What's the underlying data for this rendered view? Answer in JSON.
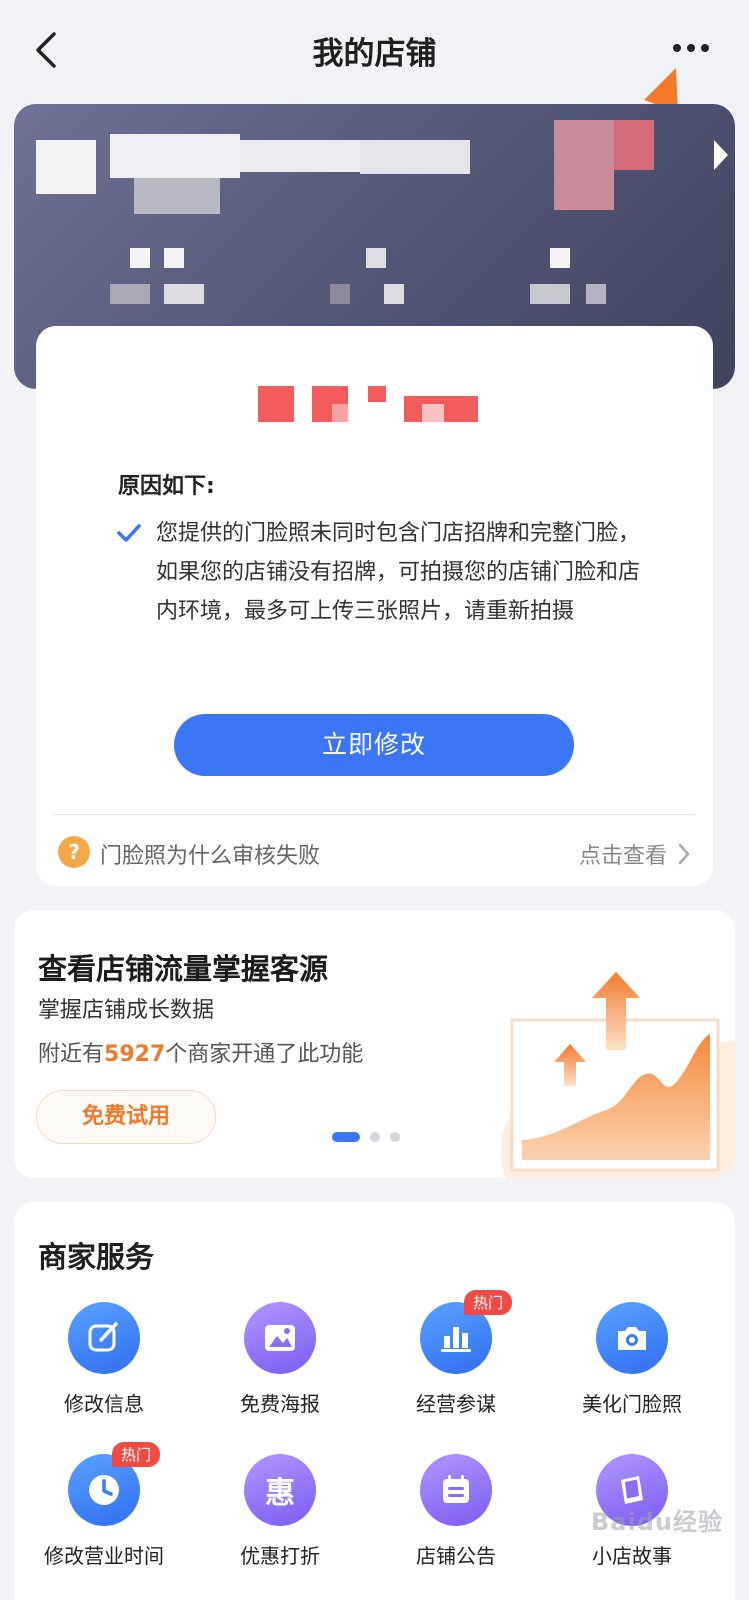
{
  "header": {
    "title": "我的店铺"
  },
  "review": {
    "reason_title": "原因如下:",
    "reason_text": "您提供的门脸照未同时包含门店招牌和完整门脸，如果您的店铺没有招牌，可拍摄您的店铺门脸和店内环境，最多可上传三张照片，请重新拍摄",
    "fix_button": "立即修改",
    "help_text": "门脸照为什么审核失败",
    "view_link": "点击查看"
  },
  "promo": {
    "title": "查看店铺流量掌握客源",
    "subtitle": "掌握店铺成长数据",
    "stat_prefix": "附近有",
    "stat_number": "5927",
    "stat_suffix": "个商家开通了此功能",
    "trial_button": "免费试用"
  },
  "services": {
    "title": "商家服务",
    "items": [
      {
        "label": "修改信息",
        "icon": "edit-icon",
        "hot": ""
      },
      {
        "label": "免费海报",
        "icon": "image-icon",
        "hot": ""
      },
      {
        "label": "经营参谋",
        "icon": "bar-chart-icon",
        "hot": "热门"
      },
      {
        "label": "美化门脸照",
        "icon": "camera-icon",
        "hot": ""
      },
      {
        "label": "修改营业时间",
        "icon": "clock-icon",
        "hot": "热门"
      },
      {
        "label": "优惠打折",
        "icon": "discount-icon",
        "hot": ""
      },
      {
        "label": "店铺公告",
        "icon": "notice-icon",
        "hot": ""
      },
      {
        "label": "小店故事",
        "icon": "story-icon",
        "hot": ""
      }
    ],
    "discount_glyph": "惠"
  },
  "help_glyph": "?",
  "watermark": "Baidu经验",
  "colors": {
    "accent": "#3a76f5",
    "promo_orange": "#f07a2a",
    "hot_badge": "#f04a44",
    "annotation_arrow": "#f47a2a"
  }
}
